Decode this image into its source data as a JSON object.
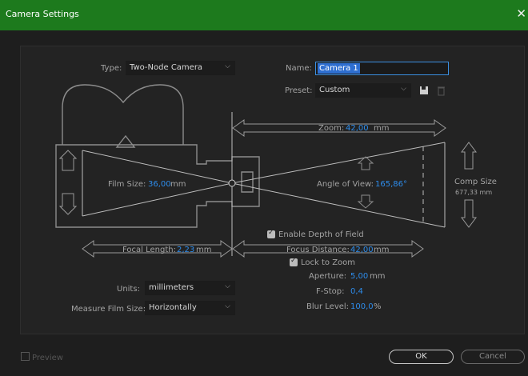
{
  "window": {
    "title": "Camera Settings",
    "close_glyph": "✕"
  },
  "type": {
    "label": "Type:",
    "value": "Two-Node Camera"
  },
  "name": {
    "label": "Name:",
    "value": "Camera 1"
  },
  "preset": {
    "label": "Preset:",
    "value": "Custom",
    "save_icon": "save-preset-icon",
    "delete_icon": "trash-icon"
  },
  "zoom": {
    "label": "Zoom:",
    "value": "42,00",
    "unit": "mm"
  },
  "film_size": {
    "label": "Film Size:",
    "value": "36,00",
    "unit": "mm"
  },
  "angle_of_view": {
    "label": "Angle of View:",
    "value": "165,86",
    "unit": "°"
  },
  "comp_size": {
    "label": "Comp Size",
    "value": "677,33 mm"
  },
  "dof": {
    "enable_label": "Enable Depth of Field",
    "enabled": true
  },
  "focal_length": {
    "label": "Focal Length:",
    "value": "2,23",
    "unit": "mm"
  },
  "focus_distance": {
    "label": "Focus Distance:",
    "value": "42,00",
    "unit": "mm"
  },
  "lock_to_zoom": {
    "label": "Lock to Zoom",
    "checked": true
  },
  "aperture": {
    "label": "Aperture:",
    "value": "5,00",
    "unit": "mm"
  },
  "fstop": {
    "label": "F-Stop:",
    "value": "0,4"
  },
  "blur_level": {
    "label": "Blur Level:",
    "value": "100,0",
    "unit": "%"
  },
  "units": {
    "label": "Units:",
    "value": "millimeters"
  },
  "measure_film_size": {
    "label": "Measure Film Size:",
    "value": "Horizontally"
  },
  "preview": {
    "label": "Preview",
    "checked": false
  },
  "buttons": {
    "ok": "OK",
    "cancel": "Cancel"
  },
  "colors": {
    "titlebar": "#1d7a1d",
    "accent_value": "#2d8ceb",
    "panel": "#232323",
    "background": "#1e1e1e"
  }
}
